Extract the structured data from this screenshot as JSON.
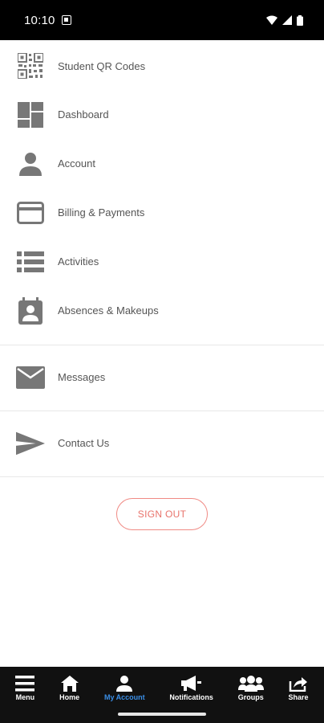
{
  "status_bar": {
    "time": "10:10"
  },
  "menu": {
    "items": [
      {
        "label": "Student QR Codes",
        "icon": "qr-code-icon"
      },
      {
        "label": "Dashboard",
        "icon": "dashboard-icon"
      },
      {
        "label": "Account",
        "icon": "person-icon"
      },
      {
        "label": "Billing & Payments",
        "icon": "credit-card-icon"
      },
      {
        "label": "Activities",
        "icon": "list-icon"
      },
      {
        "label": "Absences & Makeups",
        "icon": "badge-icon"
      },
      {
        "label": "Messages",
        "icon": "envelope-icon"
      },
      {
        "label": "Contact Us",
        "icon": "send-icon"
      }
    ]
  },
  "signout": {
    "label": "SIGN OUT",
    "color": "#e8736b"
  },
  "bottom_nav": {
    "items": [
      {
        "label": "Menu",
        "icon": "hamburger-icon"
      },
      {
        "label": "Home",
        "icon": "home-icon"
      },
      {
        "label": "My Account",
        "icon": "person-icon",
        "active": true
      },
      {
        "label": "Notifications",
        "icon": "megaphone-icon"
      },
      {
        "label": "Groups",
        "icon": "groups-icon"
      },
      {
        "label": "Share",
        "icon": "share-icon"
      }
    ],
    "active_color": "#3a8ee6"
  }
}
